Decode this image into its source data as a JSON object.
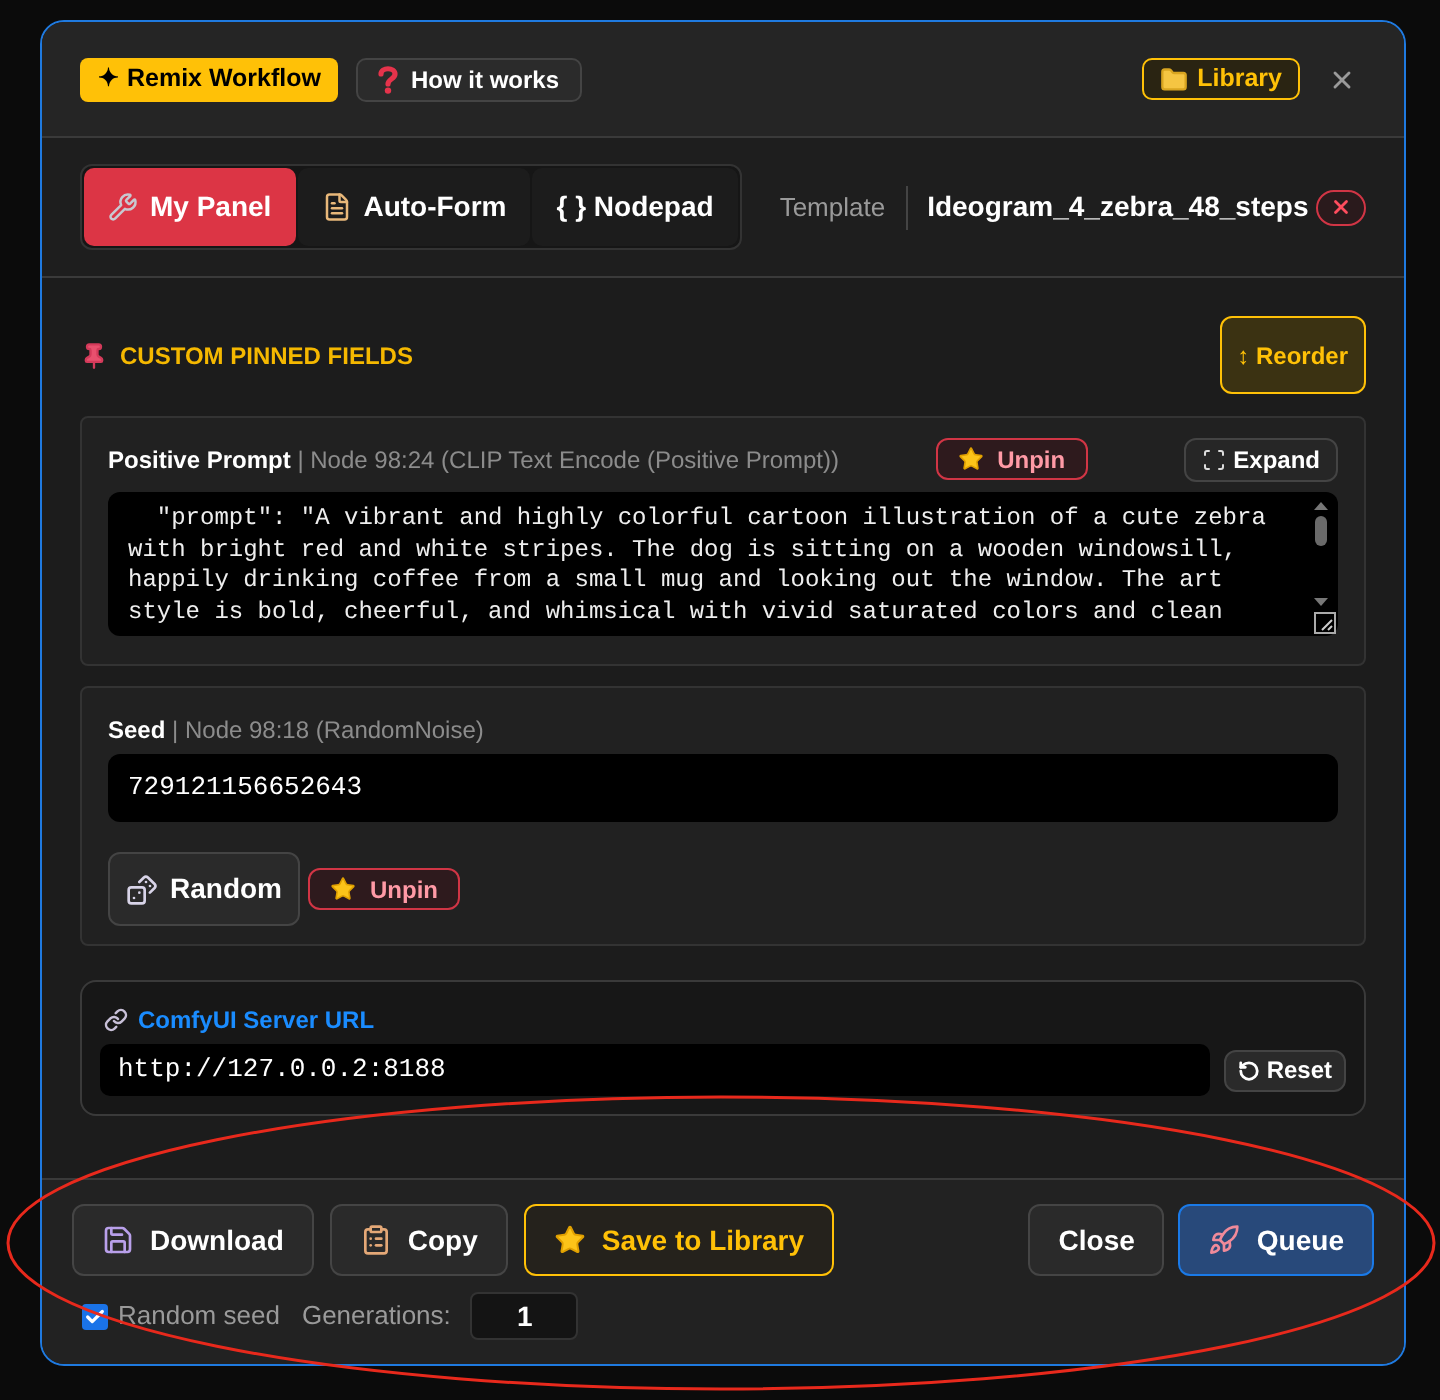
{
  "header": {
    "buttons": [
      {
        "kind": "filled",
        "label": "✦ Remix Workflow"
      },
      {
        "kind": "plain",
        "label": "How it works"
      }
    ],
    "library": {
      "label": "Library"
    }
  },
  "tabs": [
    {
      "label": "My Panel",
      "selected": true
    },
    {
      "label": "Auto-Form",
      "selected": false
    },
    {
      "label": "{ } Nodepad",
      "selected": false
    }
  ],
  "template": {
    "label": "Template",
    "name": "Ideogram_4_zebra_48_steps"
  },
  "pinned": {
    "title": "CUSTOM PINNED FIELDS",
    "reorder": "↕ Reorder",
    "fields": [
      {
        "kind": "textarea",
        "label": "**Positive Prompt** | Node 98:24 (CLIP Text Encode (Positive Prompt))",
        "unpin": "Unpin",
        "expand": "Expand",
        "value": "  \"prompt\": \"A vibrant and highly colorful cartoon illustration of a cute zebra with bright red and white stripes. The dog is sitting on a wooden windowsill, happily drinking coffee from a small mug and looking out the window. The art style is bold, cheerful, and whimsical with vivid saturated colors and clean"
      },
      {
        "kind": "input",
        "label": "**Seed** | Node 98:18 (RandomNoise)",
        "value": "729121156652643",
        "random": "Random",
        "unpin": "Unpin"
      }
    ]
  },
  "server": {
    "label": "ComfyUI Server URL",
    "value": "http://127.0.0.2:8188",
    "reset": "Reset"
  },
  "footer": {
    "left_buttons": [
      {
        "kind": "plain",
        "label": "Download"
      },
      {
        "kind": "plain",
        "label": "Copy"
      },
      {
        "kind": "accent",
        "label": "Save to Library"
      }
    ],
    "right_buttons": [
      {
        "kind": "plain",
        "label": "Close"
      },
      {
        "kind": "primary",
        "label": "Queue"
      }
    ],
    "random_seed": {
      "label": "Random seed",
      "checked": true
    },
    "generations": {
      "label": "Generations:",
      "value": "1"
    }
  }
}
